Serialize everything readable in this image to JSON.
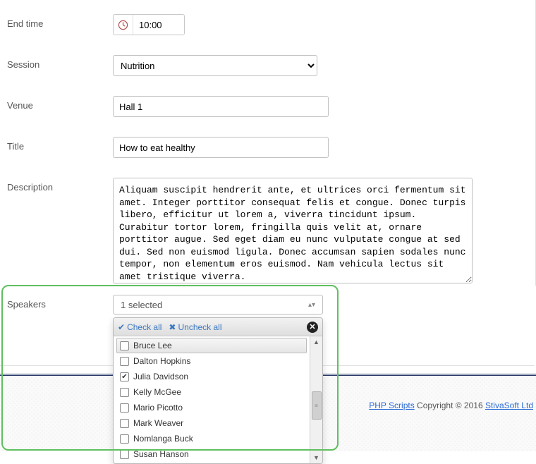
{
  "fields": {
    "end_time": {
      "label": "End time",
      "value": "10:00"
    },
    "session": {
      "label": "Session",
      "value": "Nutrition"
    },
    "venue": {
      "label": "Venue",
      "value": "Hall 1"
    },
    "title": {
      "label": "Title",
      "value": "How to eat healthy"
    },
    "description": {
      "label": "Description",
      "value": "Aliquam suscipit hendrerit ante, et ultrices orci fermentum sit amet. Integer porttitor consequat felis et congue. Donec turpis libero, efficitur ut lorem a, viverra tincidunt ipsum. Curabitur tortor lorem, fringilla quis velit at, ornare porttitor augue. Sed eget diam eu nunc vulputate congue at sed dui. Sed non euismod ligula. Donec accumsan sapien sodales nunc tempor, non elementum eros euismod. Nam vehicula lectus sit amet tristique viverra."
    },
    "speakers": {
      "label": "Speakers",
      "summary": "1 selected",
      "check_all": "Check all",
      "uncheck_all": "Uncheck all",
      "options": [
        {
          "label": "Bruce Lee",
          "checked": false,
          "highlighted": true
        },
        {
          "label": "Dalton Hopkins",
          "checked": false
        },
        {
          "label": "Julia Davidson",
          "checked": true
        },
        {
          "label": "Kelly McGee",
          "checked": false
        },
        {
          "label": "Mario Picotto",
          "checked": false
        },
        {
          "label": "Mark Weaver",
          "checked": false
        },
        {
          "label": "Nomlanga Buck",
          "checked": false
        },
        {
          "label": "Susan Hanson",
          "checked": false
        }
      ]
    }
  },
  "footer": {
    "link1": "PHP Scripts",
    "mid": " Copyright © 2016 ",
    "link2": "StivaSoft Ltd"
  }
}
